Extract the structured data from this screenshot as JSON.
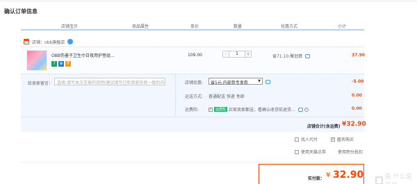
{
  "header": {
    "title": "确认订单信息"
  },
  "columns": [
    "店铺宝贝",
    "商品属性",
    "单价",
    "数量",
    "优惠方式",
    "小计"
  ],
  "shop": {
    "label": "店铺：",
    "name": "obb旗舰店"
  },
  "item": {
    "name": "OBB伤墨子卫生巾日夜用护垫组...",
    "badges": [
      "7",
      "⊕",
      "₮"
    ],
    "price": "109.00",
    "quantity": "1",
    "minus": "-",
    "plus": "+",
    "discount": "省71.10:聚划算",
    "subtotal": "37.90"
  },
  "options": {
    "message_label": "给卖家留言：",
    "message_placeholder": "选填:填写本次交易的说明(建议填写已和卖家协商一致的内容)",
    "coupon_label": "店铺优惠:",
    "coupon_selected": "省5元:内部券专享券",
    "coupon_amount": "-5.00",
    "shipping_label": "运送方式:",
    "shipping_value": "普通配送 快递 免邮",
    "shipping_amount": "0.00",
    "insurance_label": "运费险:",
    "insurance_tag": "运费险",
    "insurance_text": "买家卖家都送，看确认收货前退货...",
    "insurance_amount": "0.00"
  },
  "totals": {
    "label": "店铺合计(含运费)",
    "amount": "¥32.90"
  },
  "extras": {
    "proxy_pay": "找人代付",
    "anonymous": "匿名购买",
    "tmall_coupon": "使用天猫点券",
    "tmall_points": "使用积分抵扣"
  },
  "pay": {
    "label": "实付款：",
    "currency": "¥",
    "amount": "32.90"
  },
  "watermark": {
    "text": "值 什么值得买"
  },
  "colors": {
    "accent": "#ff4400",
    "link": "#3aa0ff",
    "header_line": "#b2d1ff",
    "panel": "#f2f7ff"
  }
}
